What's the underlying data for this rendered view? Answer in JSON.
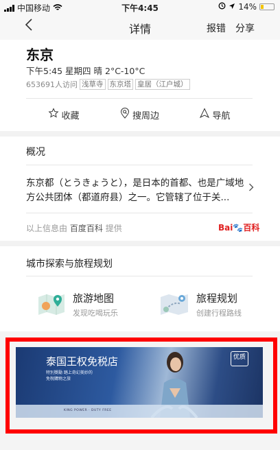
{
  "status_bar": {
    "carrier": "中国移动",
    "time": "下午4:45",
    "battery": "14%"
  },
  "nav": {
    "back_icon": "chevron-left-icon",
    "title": "详情",
    "report_label": "报错",
    "share_label": "分享"
  },
  "place": {
    "name": "东京",
    "weather": "下午5:45 星期四 晴 2°C-10°C",
    "visits": "653691人访问",
    "tags": [
      "浅草寺",
      "东京塔",
      "皇居（江户城）"
    ]
  },
  "actions": [
    {
      "label": "收藏",
      "icon": "star-icon"
    },
    {
      "label": "搜周边",
      "icon": "location-search-icon"
    },
    {
      "label": "导航",
      "icon": "navigate-icon"
    }
  ],
  "overview": {
    "title": "概况",
    "text": "东京都（とうきょうと），是日本的首都、也是广域地方公共团体（都道府县）之一。它管辖了位于关...",
    "source_prefix": "以上信息由",
    "source_name": "百度百科",
    "source_suffix": "提供",
    "logo_text_a": "Bai",
    "logo_text_b": "百科"
  },
  "explore": {
    "title": "城市探索与旅程规划",
    "items": [
      {
        "title": "旅游地图",
        "subtitle": "发现吃喝玩乐",
        "icon": "travel-map-icon"
      },
      {
        "title": "旅程规划",
        "subtitle": "创建行程路线",
        "icon": "route-plan-icon"
      }
    ]
  },
  "ad": {
    "headline": "泰国王权免税店",
    "sub1": "特別獎勵 踏上奇幻美妙的",
    "sub2": "免稅購物之旅",
    "badge": "优质",
    "footer": "KING POWER · DUTY FREE"
  },
  "colors": {
    "highlight_border": "#ff0000",
    "baidu_red": "#e02020",
    "baidu_blue": "#2152d8"
  }
}
